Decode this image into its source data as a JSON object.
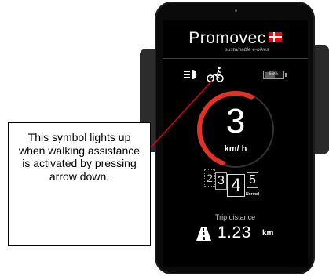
{
  "display": {
    "brand": "Promovec",
    "slogan": "sustainable e-bikes",
    "battery_percent": "56%",
    "battery_level": 0.56,
    "speed_value": "3",
    "speed_unit": "km/ h",
    "speed_gauge_fraction": 0.62,
    "assist_levels": [
      "2",
      "3",
      "4",
      "5"
    ],
    "active_assist_level": "4",
    "mode_label": "Normal",
    "trip_label": "Trip distance",
    "trip_value": "1.23",
    "trip_unit": "km"
  },
  "icons": {
    "light": "headlight-icon",
    "walk_assist": "walk-assist-icon",
    "battery": "battery-icon",
    "trip": "road-icon"
  },
  "colors": {
    "gauge_arc": "#e33225",
    "brand_flag": "#e20c1b"
  },
  "callout": {
    "text": "This symbol lights up when walking assistance is activated by pressing arrow down."
  }
}
